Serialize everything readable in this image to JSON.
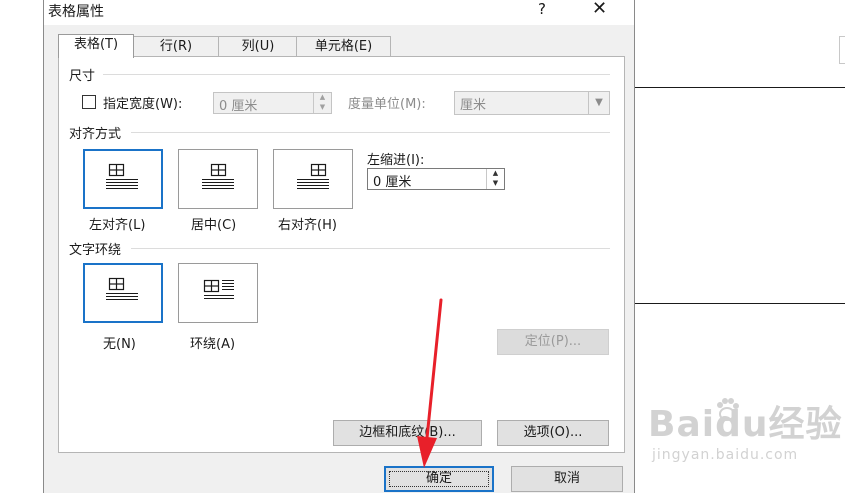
{
  "dialog": {
    "title": "表格属性",
    "help_icon": "?",
    "close_icon": "✕"
  },
  "tabs": [
    {
      "label": "表格(T)",
      "active": true
    },
    {
      "label": "行(R)",
      "active": false
    },
    {
      "label": "列(U)",
      "active": false
    },
    {
      "label": "单元格(E)",
      "active": false
    }
  ],
  "size": {
    "group_title": "尺寸",
    "width_checkbox_label": "指定宽度(W):",
    "width_checked": false,
    "width_value": "0 厘米",
    "unit_label": "度量单位(M):",
    "unit_value": "厘米"
  },
  "alignment": {
    "group_title": "对齐方式",
    "options": [
      {
        "label": "左对齐(L)",
        "selected": true,
        "icon": "align-left-icon"
      },
      {
        "label": "居中(C)",
        "selected": false,
        "icon": "align-center-icon"
      },
      {
        "label": "右对齐(H)",
        "selected": false,
        "icon": "align-right-icon"
      }
    ],
    "indent_label": "左缩进(I):",
    "indent_value": "0 厘米"
  },
  "wrapping": {
    "group_title": "文字环绕",
    "options": [
      {
        "label": "无(N)",
        "selected": true,
        "icon": "wrap-none-icon"
      },
      {
        "label": "环绕(A)",
        "selected": false,
        "icon": "wrap-around-icon"
      }
    ],
    "position_button": "定位(P)..."
  },
  "buttons": {
    "borders_shading": "边框和底纹(B)...",
    "options": "选项(O)...",
    "ok": "确定",
    "cancel": "取消"
  },
  "watermark": {
    "brand": "Baidu经验",
    "sub": "jingyan.baidu.com"
  },
  "colors": {
    "selection_blue": "#1a73c8",
    "annotation_arrow": "#e8202a"
  }
}
